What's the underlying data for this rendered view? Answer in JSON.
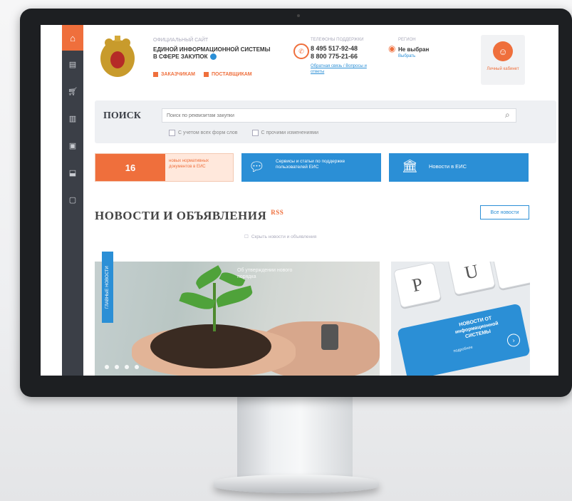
{
  "colors": {
    "accent": "#ef6f3c",
    "primary": "#2b8fd6",
    "sidebar": "#3b3f47"
  },
  "sidebar": {
    "icons": [
      "home-icon",
      "list-icon",
      "cart-icon",
      "book-icon",
      "document-icon",
      "briefcase-icon",
      "chat-icon"
    ]
  },
  "header": {
    "small_title": "ОФИЦИАЛЬНЫЙ САЙТ",
    "main_title": "ЕДИНОЙ ИНФОРМАЦИОННОЙ СИСТЕМЫ В СФЕРЕ ЗАКУПОК",
    "role_customers": "ЗАКАЗЧИКАМ",
    "role_suppliers": "ПОСТАВЩИКАМ",
    "phone_label": "ТЕЛЕФОНЫ ПОДДЕРЖКИ",
    "phone1": "8 495 517-92-48",
    "phone2": "8 800 775-21-66",
    "phone_link": "Обратная связь / Вопросы и ответы",
    "region_label": "РЕГИОН",
    "region_value": "Не выбран",
    "region_change": "Выбрать",
    "login_label": "Личный кабинет"
  },
  "search": {
    "title": "ПОИСК",
    "placeholder": "Поиск по реквизитам закупки",
    "option1": "С учетом всех форм слов",
    "option2": "С прочими изменениями"
  },
  "promos": {
    "count": "16",
    "count_text": "новых нормативных документов в ЕИС",
    "support_text": "Сервисы и статьи по поддержке пользователей ЕИС",
    "bank_text": "Новости в ЕИС"
  },
  "news": {
    "title": "НОВОСТИ И ОБЪЯВЛЕНИЯ",
    "rss": "RSS",
    "all_button": "Все новости",
    "filter_text": "Скрыть новости и объявления",
    "vertical_tab": "ГЛАВНЫЕ НОВОСТИ",
    "slide1_text": "Об утверждении нового порядка",
    "slide2_title": "НОВОСТИ ОТ информационной СИСТЕМЫ",
    "slide2_sub": "подробнее",
    "key_p": "P",
    "key_u": "U",
    "slide_count": 4
  }
}
